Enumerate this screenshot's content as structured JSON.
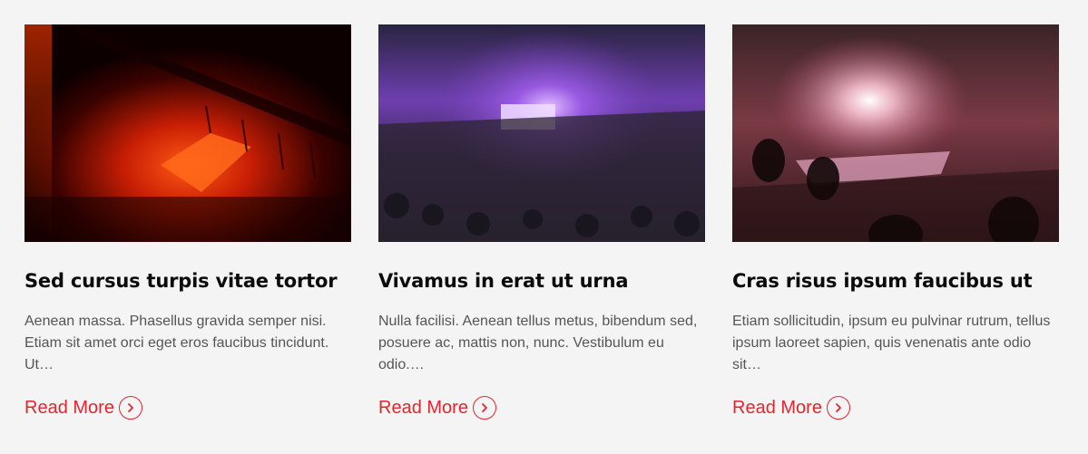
{
  "colors": {
    "background": "#f5f4f4",
    "accent": "#e3262e",
    "title": "#0b0b0b",
    "body_text": "#555555"
  },
  "cards": [
    {
      "image_icon": "concert-red-stage-photo",
      "title": "Sed cursus turpis vitae tortor",
      "excerpt": "Aenean massa. Phasellus gravida semper nisi. Etiam sit amet orci eget eros faucibus tincidunt. Ut…",
      "link_label": "Read More",
      "link_icon": "chevron-right-circle-icon"
    },
    {
      "image_icon": "concert-purple-arena-photo",
      "title": "Vivamus in erat ut urna",
      "excerpt": "Nulla facilisi. Aenean tellus metus, bibendum sed, posuere ac, mattis non, nunc. Vestibulum eu odio.…",
      "link_label": "Read More",
      "link_icon": "chevron-right-circle-icon"
    },
    {
      "image_icon": "concert-pink-lights-photo",
      "title": "Cras risus ipsum faucibus ut",
      "excerpt": "Etiam sollicitudin, ipsum eu pulvinar rutrum, tellus ipsum laoreet sapien, quis venenatis ante odio sit…",
      "link_label": "Read More",
      "link_icon": "chevron-right-circle-icon"
    }
  ]
}
